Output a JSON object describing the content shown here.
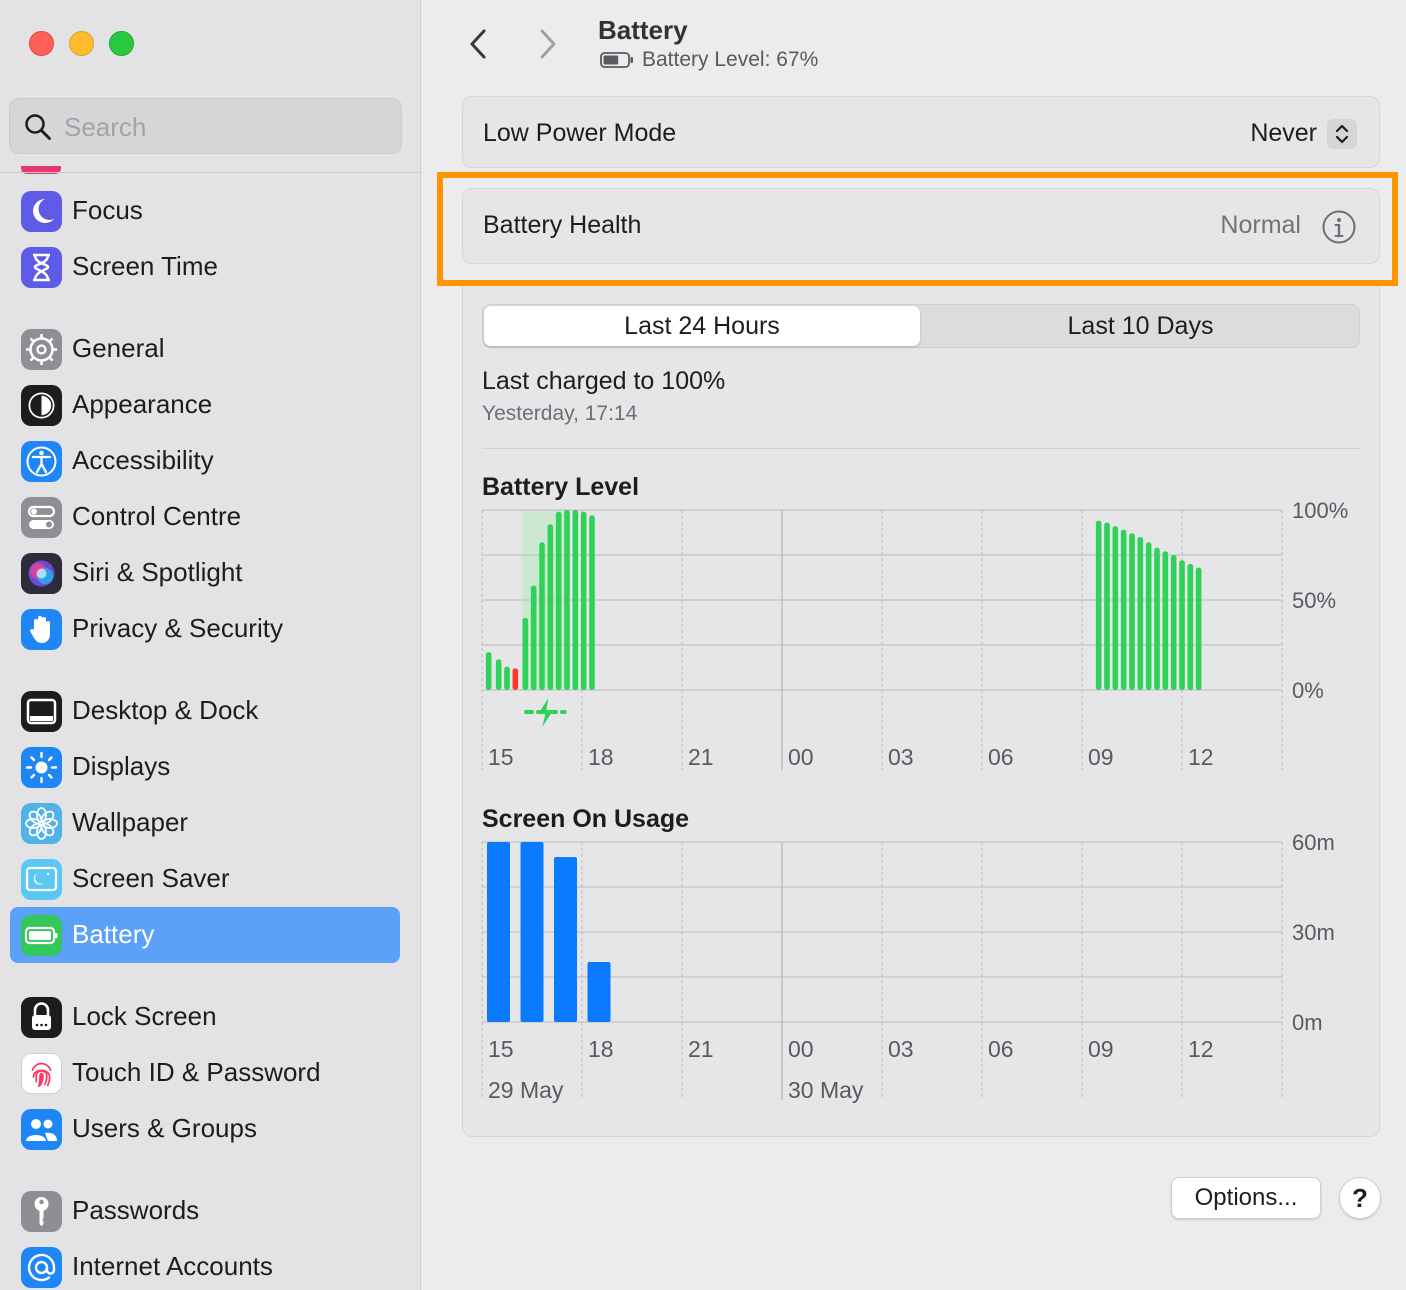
{
  "window": {
    "title": "Battery",
    "subtitle": "Battery Level: 67%",
    "battery_level": 0.67
  },
  "search": {
    "placeholder": "Search"
  },
  "sidebar": {
    "items": [
      {
        "label": "Focus",
        "icon": "moon-icon",
        "color": "#5e5ce6"
      },
      {
        "label": "Screen Time",
        "icon": "hourglass-icon",
        "color": "#5e5ce6"
      },
      {
        "label": "General",
        "icon": "gear-icon",
        "color": "#8e8e93"
      },
      {
        "label": "Appearance",
        "icon": "appearance-icon",
        "color": "#1c1c1e"
      },
      {
        "label": "Accessibility",
        "icon": "accessibility-icon",
        "color": "#1e86f5"
      },
      {
        "label": "Control Centre",
        "icon": "toggles-icon",
        "color": "#8e8e93"
      },
      {
        "label": "Siri & Spotlight",
        "icon": "siri-icon",
        "color": "#2c2c3a"
      },
      {
        "label": "Privacy & Security",
        "icon": "hand-icon",
        "color": "#1e86f5"
      },
      {
        "label": "Desktop & Dock",
        "icon": "dock-icon",
        "color": "#1c1c1e"
      },
      {
        "label": "Displays",
        "icon": "sun-icon",
        "color": "#1e86f5"
      },
      {
        "label": "Wallpaper",
        "icon": "flower-icon",
        "color": "#4fb3e8"
      },
      {
        "label": "Screen Saver",
        "icon": "screensaver-icon",
        "color": "#5ac8f5"
      },
      {
        "label": "Battery",
        "icon": "battery-icon",
        "color": "#34c759"
      },
      {
        "label": "Lock Screen",
        "icon": "lock-icon",
        "color": "#1c1c1e"
      },
      {
        "label": "Touch ID & Password",
        "icon": "fingerprint-icon",
        "color": "#ffffff"
      },
      {
        "label": "Users & Groups",
        "icon": "users-icon",
        "color": "#1e86f5"
      },
      {
        "label": "Passwords",
        "icon": "key-icon",
        "color": "#8e8e93"
      },
      {
        "label": "Internet Accounts",
        "icon": "at-icon",
        "color": "#1e86f5"
      }
    ],
    "active": "Battery"
  },
  "low_power": {
    "label": "Low Power Mode",
    "value": "Never"
  },
  "health": {
    "label": "Battery Health",
    "value": "Normal"
  },
  "tabs": {
    "selected": "Last 24 Hours",
    "other": "Last 10 Days"
  },
  "last_charged": {
    "title": "Last charged to 100%",
    "time": "Yesterday, 17:14"
  },
  "colors": {
    "accent": "#5ba1f8",
    "battery_bar": "#30d158",
    "battery_low": "#ff3b30",
    "charging_band": "#c5e8c9",
    "usage_bar": "#0a7aff",
    "highlight": "#ff9500"
  },
  "chart_data": [
    {
      "type": "bar",
      "title": "Battery Level",
      "ylabels": [
        "100%",
        "50%",
        "0%"
      ],
      "ylim": [
        0,
        100
      ],
      "xlabels": [
        "15",
        "18",
        "21",
        "00",
        "03",
        "06",
        "09",
        "12"
      ],
      "date_labels": [],
      "series": [
        {
          "values": [
            [
              14.7,
              21
            ],
            [
              15.0,
              17
            ],
            [
              15.25,
              13
            ],
            [
              15.5,
              12
            ],
            [
              15.8,
              40
            ],
            [
              16.05,
              58
            ],
            [
              16.3,
              82
            ],
            [
              16.55,
              92
            ],
            [
              16.8,
              99
            ],
            [
              17.05,
              100
            ],
            [
              17.3,
              100
            ],
            [
              17.55,
              99
            ],
            [
              17.8,
              97
            ],
            [
              9.0,
              94
            ],
            [
              9.25,
              93
            ],
            [
              9.5,
              91
            ],
            [
              9.75,
              89
            ],
            [
              10.0,
              87
            ],
            [
              10.25,
              85
            ],
            [
              10.5,
              82
            ],
            [
              10.75,
              79
            ],
            [
              11.0,
              77
            ],
            [
              11.25,
              75
            ],
            [
              11.5,
              72
            ],
            [
              11.75,
              70
            ],
            [
              12.0,
              68
            ]
          ],
          "low_index": [
            3
          ]
        }
      ],
      "charging_period": [
        15.7,
        17.1
      ]
    },
    {
      "type": "bar",
      "title": "Screen On Usage",
      "ylabels": [
        "60m",
        "30m",
        "0m"
      ],
      "ylim": [
        0,
        60
      ],
      "xlabels": [
        "15",
        "18",
        "21",
        "00",
        "03",
        "06",
        "09",
        "12"
      ],
      "date_labels": [
        "29 May",
        "30 May"
      ],
      "values": [
        60,
        60,
        55,
        20
      ]
    }
  ],
  "buttons": {
    "options": "Options...",
    "help": "?"
  }
}
